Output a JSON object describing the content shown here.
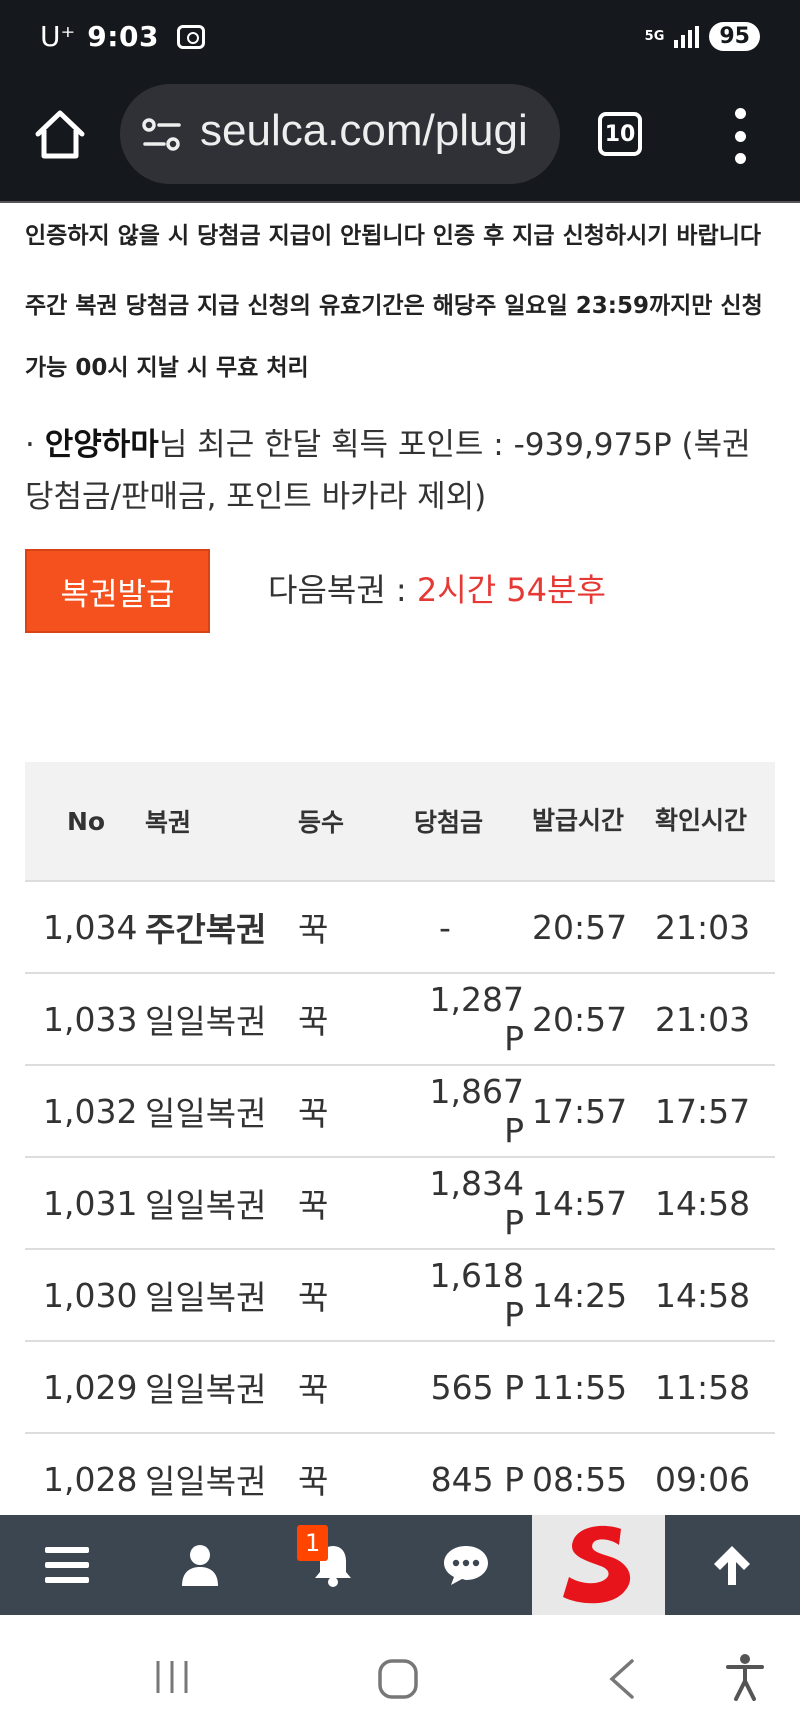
{
  "status_bar": {
    "carrier": "U⁺",
    "time": "9:03",
    "network": "5G",
    "battery": "95"
  },
  "browser": {
    "url": "seulca.com/plugi",
    "tab_count": "10"
  },
  "notices": [
    "인증하지 않을 시 당첨금 지급이 안됩니다 인증 후 지급 신청하시기 바랍니다",
    "주간 복권 당첨금 지급 신청의 유효기간은 해당주 일요일 23:59까지만 신청 가능 00시 지날 시 무효 처리"
  ],
  "points": {
    "bullet": "·",
    "nickname": "안양하마",
    "label": "님 최근 한달 획득 포인트 : ",
    "value": "-939,975P",
    "note": " (복권 당첨금/판매금, 포인트 바카라 제외)"
  },
  "issue": {
    "button_label": "복권발급",
    "next_label": "다음복권 : ",
    "next_value": "2시간 54분후"
  },
  "table": {
    "headers": [
      "No",
      "복권",
      "등수",
      "당첨금",
      "발급시간",
      "확인시간"
    ],
    "rows": [
      {
        "no": "1,034",
        "type": "주간복권",
        "grade": "꾹",
        "prize": "-",
        "issued": "20:57",
        "checked": "21:03"
      },
      {
        "no": "1,033",
        "type": "일일복권",
        "grade": "꾹",
        "prize": "1,287 P",
        "issued": "20:57",
        "checked": "21:03"
      },
      {
        "no": "1,032",
        "type": "일일복권",
        "grade": "꾹",
        "prize": "1,867 P",
        "issued": "17:57",
        "checked": "17:57"
      },
      {
        "no": "1,031",
        "type": "일일복권",
        "grade": "꾹",
        "prize": "1,834 P",
        "issued": "14:57",
        "checked": "14:58"
      },
      {
        "no": "1,030",
        "type": "일일복권",
        "grade": "꾹",
        "prize": "1,618 P",
        "issued": "14:25",
        "checked": "14:58"
      },
      {
        "no": "1,029",
        "type": "일일복권",
        "grade": "꾹",
        "prize": "565 P",
        "issued": "11:55",
        "checked": "11:58"
      },
      {
        "no": "1,028",
        "type": "일일복권",
        "grade": "꾹",
        "prize": "845 P",
        "issued": "08:55",
        "checked": "09:06"
      }
    ]
  },
  "bottom_nav": {
    "items": [
      "menu-icon",
      "user-icon",
      "bell-icon",
      "chat-icon",
      "site-logo",
      "arrow-up-icon"
    ],
    "notification_count": "1"
  },
  "colors": {
    "accent": "#f4511e",
    "countdown": "#e53935",
    "toolbar": "#3c4650",
    "logo_red": "#e8141b"
  }
}
